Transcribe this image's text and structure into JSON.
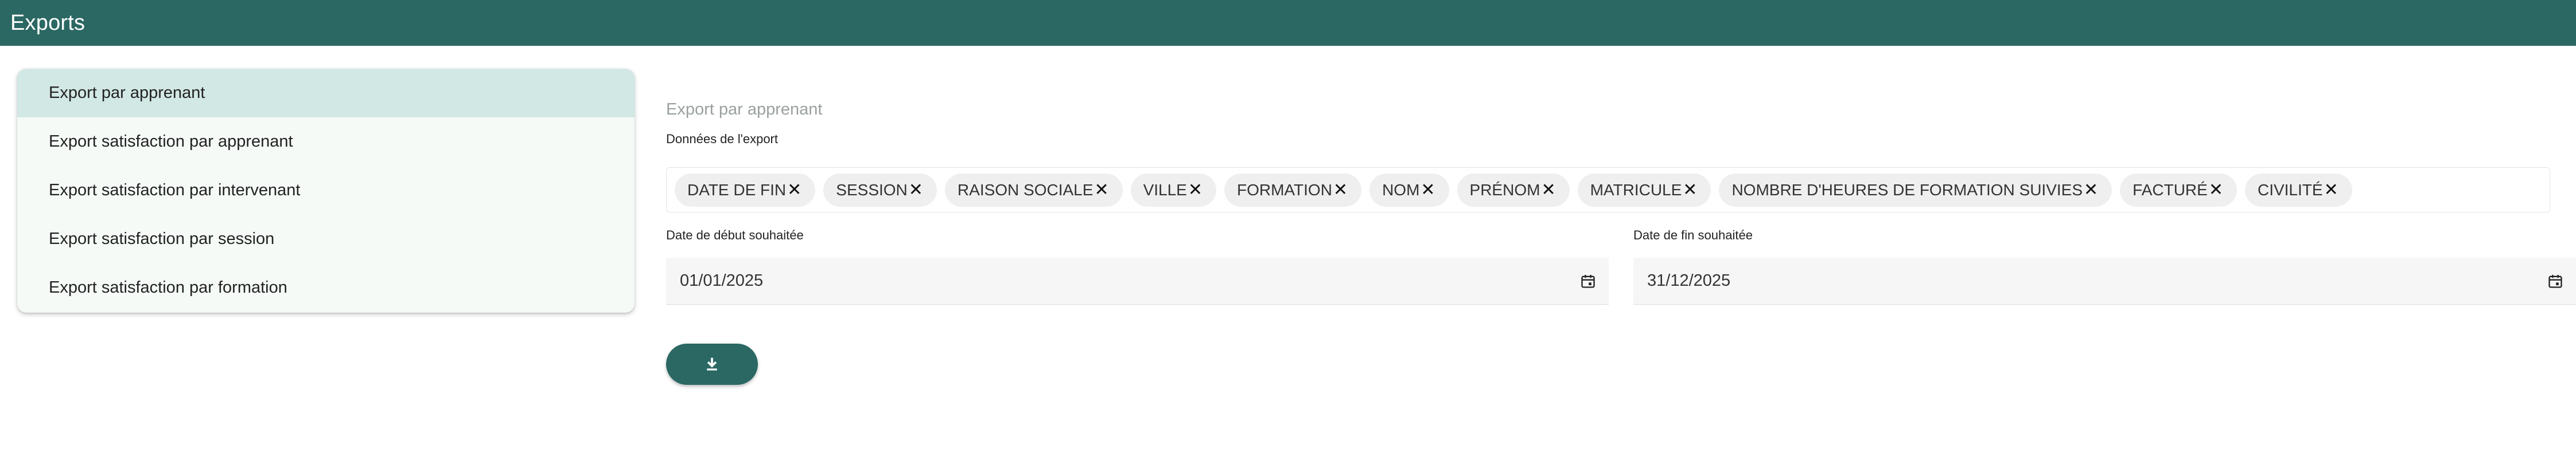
{
  "header": {
    "title": "Exports"
  },
  "menu": {
    "items": [
      {
        "label": "Export par apprenant",
        "active": true
      },
      {
        "label": "Export satisfaction par apprenant",
        "active": false
      },
      {
        "label": "Export satisfaction par intervenant",
        "active": false
      },
      {
        "label": "Export satisfaction par session",
        "active": false
      },
      {
        "label": "Export satisfaction par formation",
        "active": false
      }
    ]
  },
  "form": {
    "title": "Export par apprenant",
    "chips_label": "Données de l'export",
    "chips": [
      "DATE DE FIN",
      "SESSION",
      "RAISON SOCIALE",
      "VILLE",
      "FORMATION",
      "NOM",
      "PRÉNOM",
      "MATRICULE",
      "NOMBRE D'HEURES DE FORMATION SUIVIES",
      "FACTURÉ",
      "CIVILITÉ"
    ],
    "chip_remove_glyph": "✕",
    "start_date": {
      "label": "Date de début souhaitée",
      "value": "01/01/2025",
      "icon": "calendar-icon"
    },
    "end_date": {
      "label": "Date de fin souhaitée",
      "value": "31/12/2025",
      "icon": "calendar-icon"
    },
    "download_button": {
      "icon": "download-icon"
    }
  },
  "colors": {
    "brand": "#2b6863",
    "menu_active": "#d2e8e4",
    "menu_bg": "#f5faf7",
    "chip_bg": "#efefef"
  }
}
